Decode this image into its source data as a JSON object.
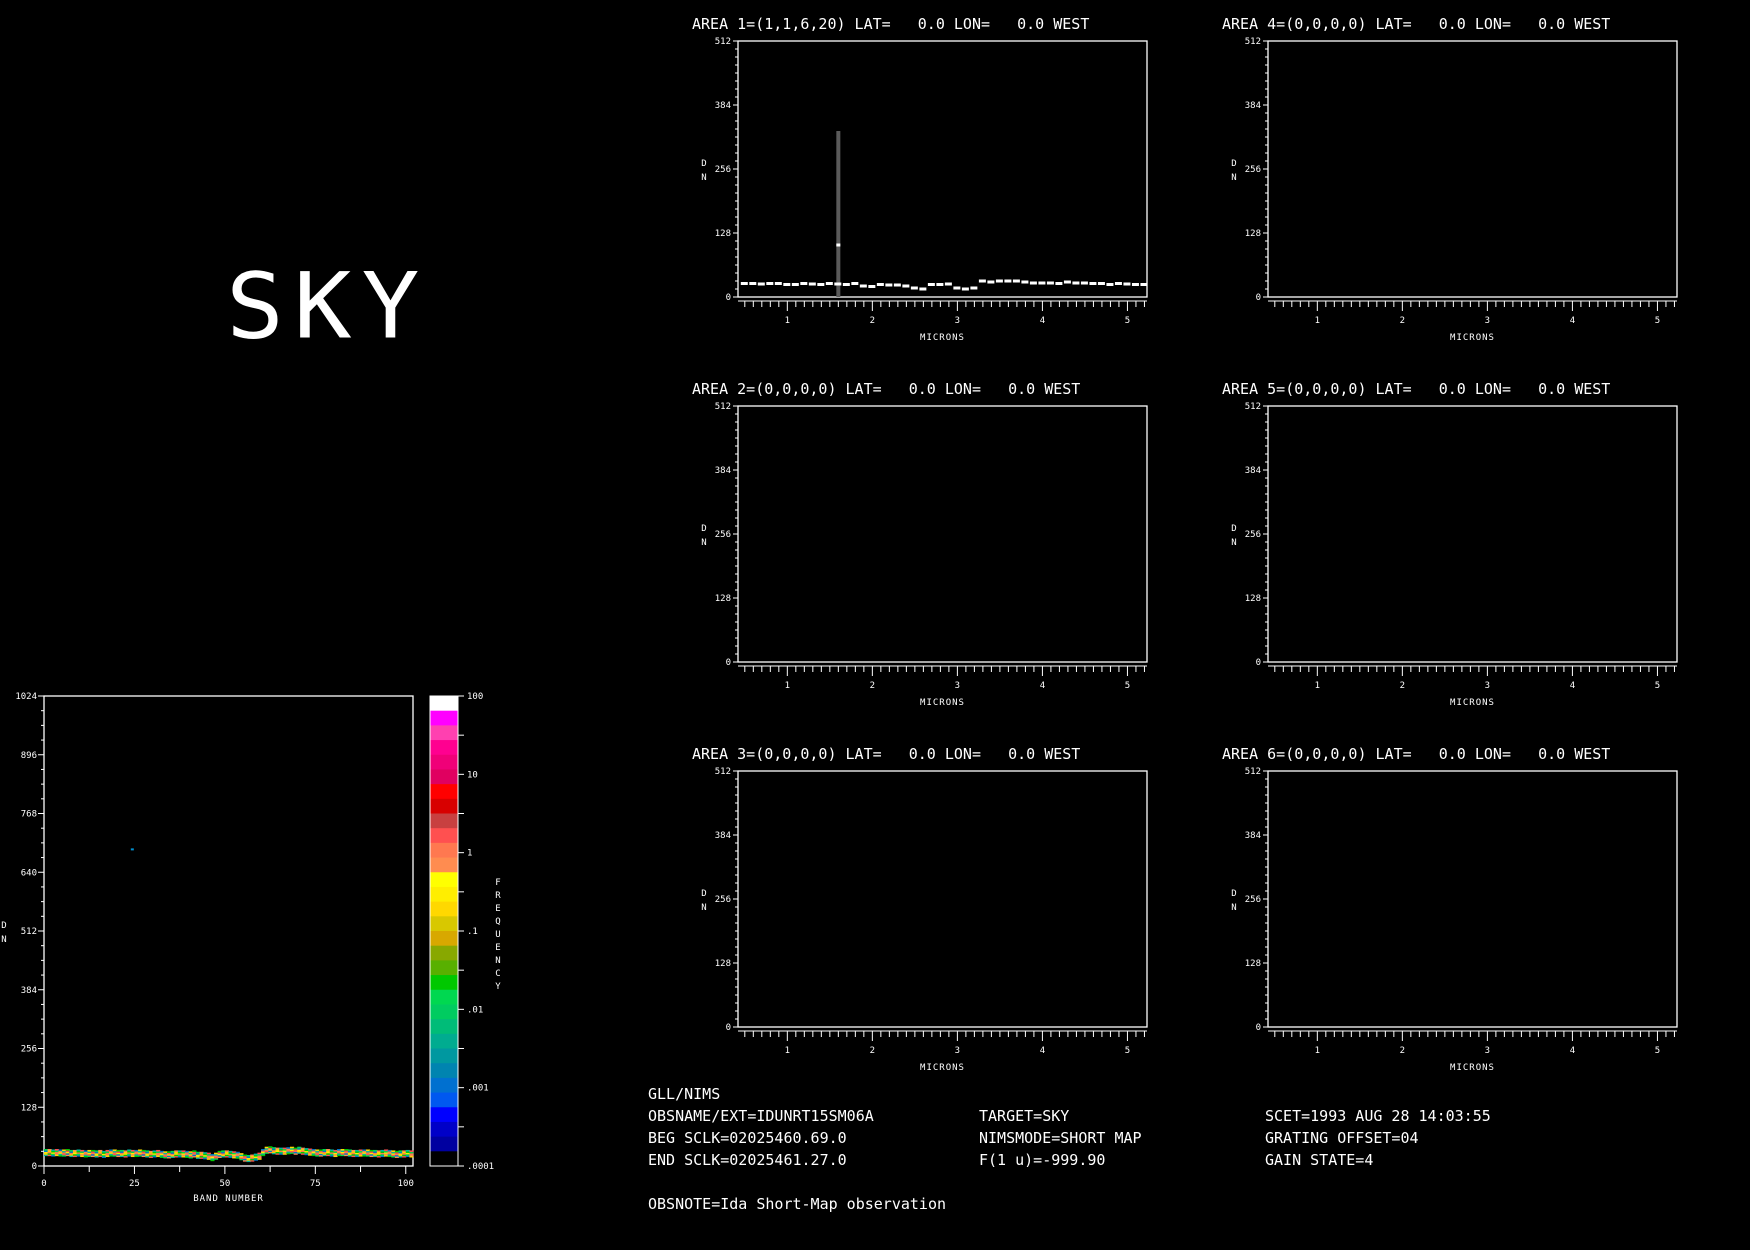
{
  "target_label": "SKY",
  "chart_data": [
    {
      "type": "line",
      "title": "AREA 1=(1,1,6,20) LAT=   0.0 LON=   0.0 WEST",
      "xlabel": "MICRONS",
      "ylabel": "D N",
      "xlim": [
        0.42,
        5.23
      ],
      "ylim": [
        0,
        512
      ],
      "xticks": [
        "1",
        "2",
        "3",
        "4",
        "5"
      ],
      "yticks": [
        "0",
        "128",
        "256",
        "384",
        "512"
      ],
      "x": [
        0.5,
        0.6,
        0.7,
        0.8,
        0.9,
        1.0,
        1.1,
        1.2,
        1.3,
        1.4,
        1.5,
        1.6,
        1.7,
        1.8,
        1.9,
        2.0,
        2.1,
        2.2,
        2.3,
        2.4,
        2.5,
        2.6,
        2.7,
        2.8,
        2.9,
        3.0,
        3.1,
        3.2,
        3.3,
        3.4,
        3.5,
        3.6,
        3.7,
        3.8,
        3.9,
        4.0,
        4.1,
        4.2,
        4.3,
        4.4,
        4.5,
        4.6,
        4.7,
        4.8,
        4.9,
        5.0,
        5.1,
        5.2
      ],
      "y": [
        27,
        27,
        26,
        27,
        27,
        25,
        25,
        27,
        26,
        25,
        27,
        26,
        25,
        27,
        22,
        21,
        25,
        24,
        24,
        22,
        18,
        16,
        25,
        25,
        26,
        18,
        16,
        18,
        32,
        30,
        32,
        32,
        32,
        30,
        28,
        28,
        28,
        27,
        30,
        28,
        28,
        27,
        27,
        25,
        27,
        26,
        25,
        25
      ],
      "marker": {
        "x": 1.6,
        "y_low": 0,
        "y_high": 332,
        "value": 105
      }
    },
    {
      "type": "line",
      "title": "AREA 2=(0,0,0,0) LAT=   0.0 LON=   0.0 WEST",
      "xlabel": "MICRONS",
      "ylabel": "D N",
      "xlim": [
        0.42,
        5.23
      ],
      "ylim": [
        0,
        512
      ],
      "xticks": [
        "1",
        "2",
        "3",
        "4",
        "5"
      ],
      "yticks": [
        "0",
        "128",
        "256",
        "384",
        "512"
      ],
      "x": [],
      "y": []
    },
    {
      "type": "line",
      "title": "AREA 3=(0,0,0,0) LAT=   0.0 LON=   0.0 WEST",
      "xlabel": "MICRONS",
      "ylabel": "D N",
      "xlim": [
        0.42,
        5.23
      ],
      "ylim": [
        0,
        512
      ],
      "xticks": [
        "1",
        "2",
        "3",
        "4",
        "5"
      ],
      "yticks": [
        "0",
        "128",
        "256",
        "384",
        "512"
      ],
      "x": [],
      "y": []
    },
    {
      "type": "line",
      "title": "AREA 4=(0,0,0,0) LAT=   0.0 LON=   0.0 WEST",
      "xlabel": "MICRONS",
      "ylabel": "D N",
      "xlim": [
        0.42,
        5.23
      ],
      "ylim": [
        0,
        512
      ],
      "xticks": [
        "1",
        "2",
        "3",
        "4",
        "5"
      ],
      "yticks": [
        "0",
        "128",
        "256",
        "384",
        "512"
      ],
      "x": [],
      "y": []
    },
    {
      "type": "line",
      "title": "AREA 5=(0,0,0,0) LAT=   0.0 LON=   0.0 WEST",
      "xlabel": "MICRONS",
      "ylabel": "D N",
      "xlim": [
        0.42,
        5.23
      ],
      "ylim": [
        0,
        512
      ],
      "xticks": [
        "1",
        "2",
        "3",
        "4",
        "5"
      ],
      "yticks": [
        "0",
        "128",
        "256",
        "384",
        "512"
      ],
      "x": [],
      "y": []
    },
    {
      "type": "line",
      "title": "AREA 6=(0,0,0,0) LAT=   0.0 LON=   0.0 WEST",
      "xlabel": "MICRONS",
      "ylabel": "D N",
      "xlim": [
        0.42,
        5.23
      ],
      "ylim": [
        0,
        512
      ],
      "xticks": [
        "1",
        "2",
        "3",
        "4",
        "5"
      ],
      "yticks": [
        "0",
        "128",
        "256",
        "384",
        "512"
      ],
      "x": [],
      "y": []
    },
    {
      "type": "heatmap",
      "xlabel": "BAND NUMBER",
      "ylabel": "D N",
      "xlim": [
        0,
        102
      ],
      "ylim": [
        0,
        1024
      ],
      "xticks": [
        "0",
        "25",
        "50",
        "75",
        "100"
      ],
      "yticks": [
        "0",
        "128",
        "256",
        "384",
        "512",
        "640",
        "768",
        "896",
        "1024"
      ],
      "band_dn": [
        28,
        28,
        27,
        28,
        27,
        27,
        28,
        26,
        26,
        27,
        26,
        25,
        26,
        26,
        25,
        26,
        24,
        26,
        27,
        27,
        26,
        26,
        25,
        27,
        26,
        26,
        27,
        26,
        25,
        24,
        25,
        26,
        24,
        23,
        23,
        24,
        25,
        25,
        25,
        24,
        23,
        25,
        22,
        22,
        21,
        20,
        17,
        20,
        24,
        25,
        25,
        24,
        23,
        22,
        19,
        16,
        15,
        16,
        18,
        20,
        28,
        33,
        34,
        32,
        31,
        31,
        31,
        32,
        33,
        31,
        33,
        31,
        30,
        29,
        28,
        27,
        27,
        28,
        28,
        27,
        26,
        28,
        28,
        28,
        27,
        26,
        26,
        27,
        27,
        27,
        26,
        26,
        25,
        26,
        27,
        26,
        25,
        24,
        25,
        25,
        26,
        25
      ],
      "outlier": {
        "band": 24,
        "dn": 692
      },
      "colorbar": {
        "label": "FREQUENCY",
        "tick_labels": [
          "100",
          "10",
          "1",
          ".1",
          ".01",
          ".001",
          ".0001"
        ],
        "colors": [
          "#ffffff",
          "#ff00ff",
          "#ff40b0",
          "#ff0090",
          "#f00078",
          "#e00060",
          "#ff0000",
          "#d80000",
          "#c84040",
          "#ff5050",
          "#ff7850",
          "#ff8c50",
          "#ffff00",
          "#ffee00",
          "#ffd800",
          "#d8c800",
          "#d8a800",
          "#88a800",
          "#58b000",
          "#00c800",
          "#00d850",
          "#00cc60",
          "#00bc78",
          "#00ac90",
          "#0098a0",
          "#0084b0",
          "#0070d0",
          "#0058f0",
          "#0000ff",
          "#0000c8",
          "#0000a0",
          "#000000"
        ]
      }
    }
  ],
  "info": {
    "instrument": "GLL/NIMS",
    "obsname": "OBSNAME/EXT=IDUNRT15SM06A",
    "beg_sclk": "BEG SCLK=02025460.69.0",
    "end_sclk": "END SCLK=02025461.27.0",
    "target": "TARGET=SKY",
    "nimsmode": "NIMSMODE=SHORT MAP",
    "f1u": "F(1 u)=-999.90",
    "scet": "SCET=1993 AUG 28 14:03:55",
    "grating": "GRATING OFFSET=04",
    "gain": "GAIN STATE=4",
    "obsnote": "OBSNOTE=Ida Short-Map observation"
  }
}
